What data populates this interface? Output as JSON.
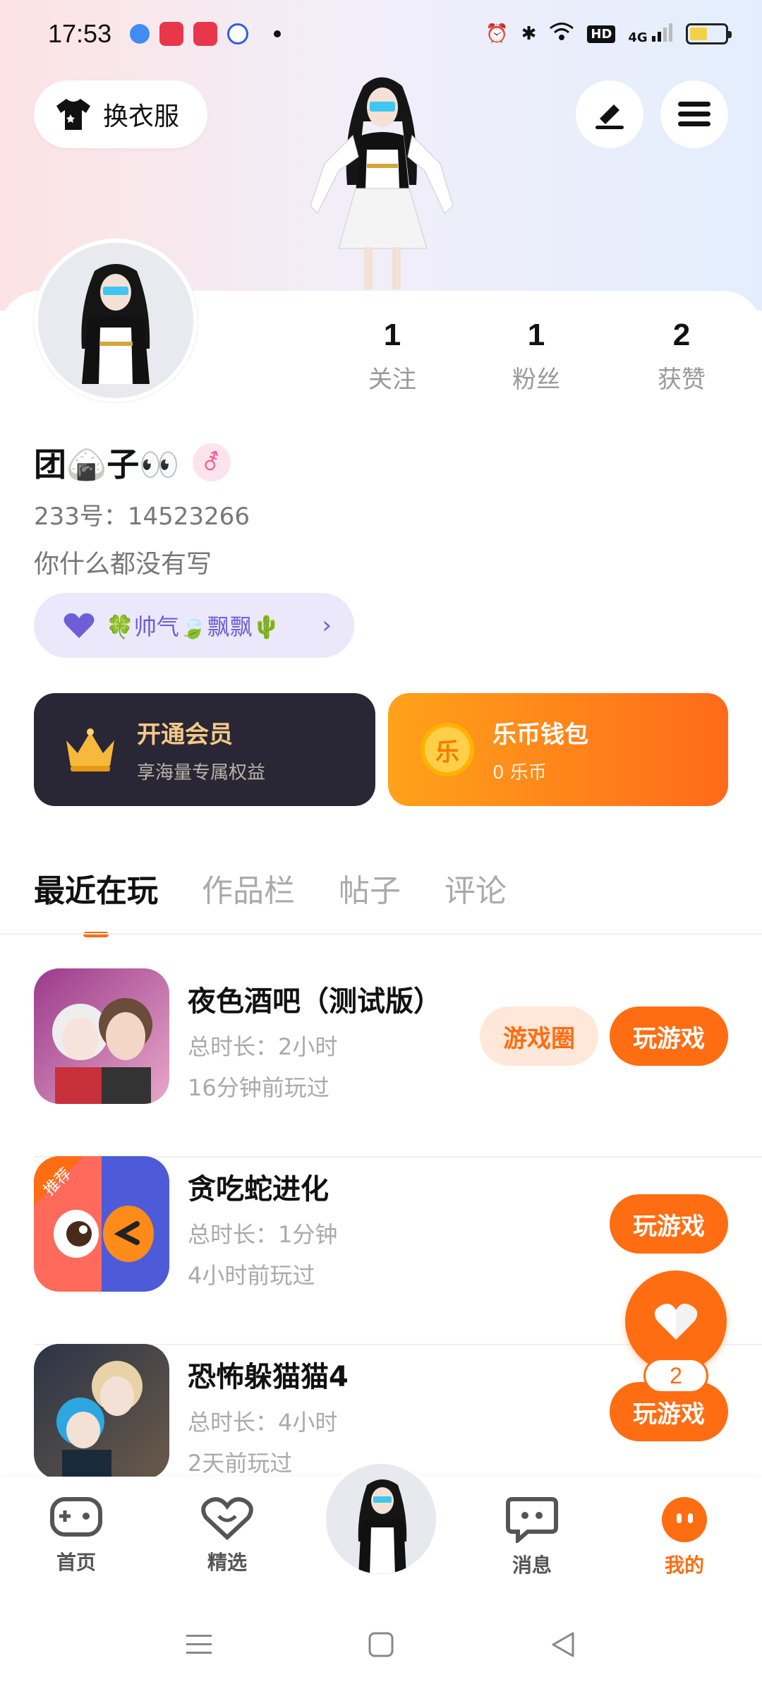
{
  "status_bar": {
    "time": "17:53",
    "network": "4G",
    "hd": "HD",
    "battery_level": 0.5
  },
  "header": {
    "outfit_label": "换衣服",
    "edit_icon": "pen-icon",
    "menu_icon": "hamburger-icon"
  },
  "profile": {
    "username": "团🍙子👀",
    "gender_symbol": "⚦",
    "uid": "233号：14523266",
    "bio": "你什么都没有写",
    "tag_text": "🍀帅气🍃飘飘🌵",
    "stats": [
      {
        "value": "1",
        "label": "关注"
      },
      {
        "value": "1",
        "label": "粉丝"
      },
      {
        "value": "2",
        "label": "获赞"
      }
    ]
  },
  "cards": {
    "vip_title": "开通会员",
    "vip_sub": "享海量专属权益",
    "wallet_title": "乐币钱包",
    "wallet_sub": "0 乐币",
    "coin_glyph": "乐"
  },
  "tabs": [
    "最近在玩",
    "作品栏",
    "帖子",
    "评论"
  ],
  "games": [
    {
      "title": "夜色酒吧（测试版）",
      "duration": "总时长：2小时",
      "last_played": "16分钟前玩过",
      "circle_label": "游戏圈",
      "play_label": "玩游戏"
    },
    {
      "title": "贪吃蛇进化",
      "duration": "总时长：1分钟",
      "last_played": "4小时前玩过",
      "play_label": "玩游戏",
      "badge": "推荐"
    },
    {
      "title": "恐怖躲猫猫4",
      "duration": "总时长：4小时",
      "last_played": "2天前玩过",
      "play_label": "玩游戏"
    }
  ],
  "fab": {
    "count": "2"
  },
  "bottom_nav": [
    {
      "label": "首页"
    },
    {
      "label": "精选"
    },
    {
      "label": "消息"
    },
    {
      "label": "我的"
    }
  ],
  "colors": {
    "accent": "#ff6d12",
    "vip_bg": "#292735",
    "tag_bg": "#ebe8fb"
  }
}
